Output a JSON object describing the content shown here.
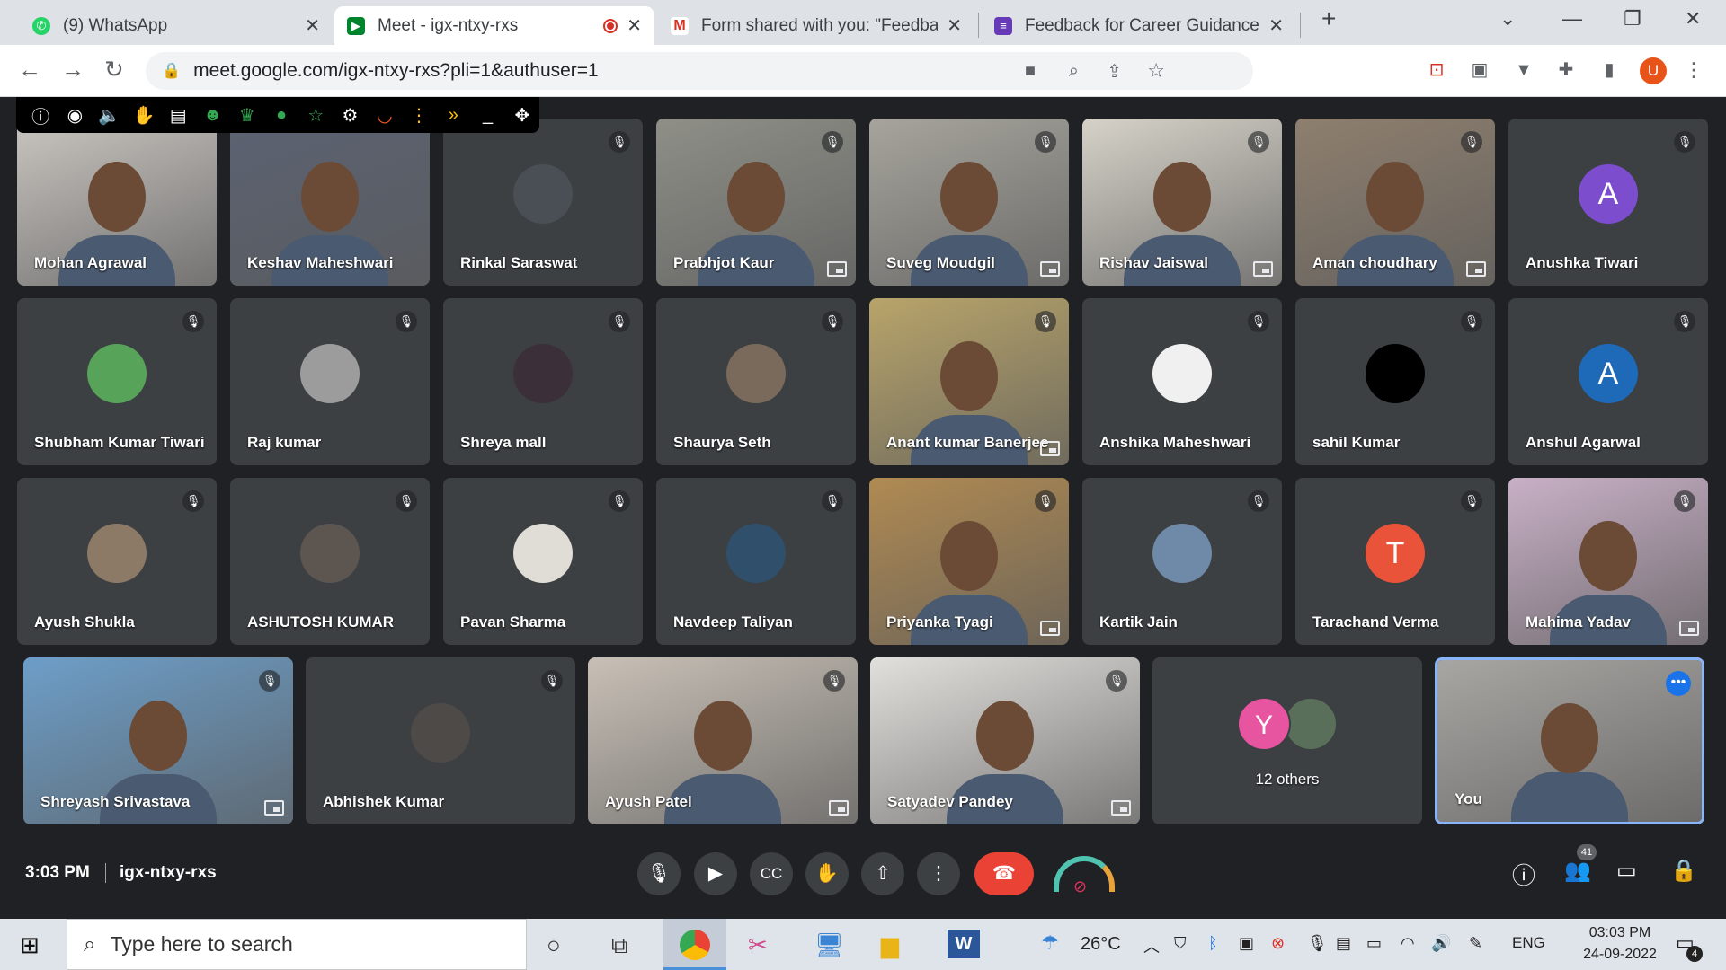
{
  "browser": {
    "tabs": [
      {
        "title": "(9) WhatsApp",
        "icon": "whatsapp-icon",
        "active": false
      },
      {
        "title": "Meet - igx-ntxy-rxs",
        "icon": "google-meet-icon",
        "active": true
      },
      {
        "title": "Form shared with you: \"Feedback",
        "icon": "gmail-icon",
        "active": false
      },
      {
        "title": "Feedback for Career Guidance Ta",
        "icon": "google-forms-icon",
        "active": false
      }
    ],
    "url": "meet.google.com/igx-ntxy-rxs?pli=1&authuser=1",
    "profile_initial": "U"
  },
  "participants": [
    {
      "name": "Mohan Agrawal",
      "kind": "video",
      "bg": "#c9c5c0",
      "muted": false
    },
    {
      "name": "Keshav Maheshwari",
      "kind": "video",
      "bg": "#5b6272",
      "muted": false
    },
    {
      "name": "Rinkal Saraswat",
      "kind": "photo",
      "bg": "#4a4f55",
      "muted": true
    },
    {
      "name": "Prabhjot Kaur",
      "kind": "video",
      "bg": "#8f8f88",
      "muted": true
    },
    {
      "name": "Suveg Moudgil",
      "kind": "video",
      "bg": "#a6a49c",
      "muted": true
    },
    {
      "name": "Rishav Jaiswal",
      "kind": "video",
      "bg": "#d6d2c8",
      "muted": true
    },
    {
      "name": "Aman choudhary",
      "kind": "video",
      "bg": "#8e7f6e",
      "muted": true
    },
    {
      "name": "Anushka Tiwari",
      "kind": "letter",
      "letter": "A",
      "color": "#7c4dcc",
      "muted": true
    },
    {
      "name": "Shubham Kumar Tiwari",
      "kind": "photo",
      "bg": "#58a35a",
      "muted": true
    },
    {
      "name": "Raj kumar",
      "kind": "photo",
      "bg": "#9c9c9c",
      "muted": true
    },
    {
      "name": "Shreya mall",
      "kind": "photo",
      "bg": "#3b2f3a",
      "muted": true
    },
    {
      "name": "Shaurya Seth",
      "kind": "photo",
      "bg": "#7a6a5c",
      "muted": true
    },
    {
      "name": "Anant kumar Banerjee",
      "kind": "video",
      "bg": "#b8a46a",
      "muted": true
    },
    {
      "name": "Anshika Maheshwari",
      "kind": "photo",
      "bg": "#f0f0f0",
      "muted": true
    },
    {
      "name": "sahil Kumar",
      "kind": "photo",
      "bg": "#000000",
      "muted": true
    },
    {
      "name": "Anshul Agarwal",
      "kind": "letter",
      "letter": "A",
      "color": "#1e6ab8",
      "muted": true
    },
    {
      "name": "Ayush Shukla",
      "kind": "photo",
      "bg": "#8d7a66",
      "muted": true
    },
    {
      "name": "ASHUTOSH KUMAR",
      "kind": "photo",
      "bg": "#5d5550",
      "muted": true
    },
    {
      "name": "Pavan Sharma",
      "kind": "photo",
      "bg": "#e0dcd6",
      "muted": true
    },
    {
      "name": "Navdeep Taliyan",
      "kind": "photo",
      "bg": "#2f4f6a",
      "muted": true
    },
    {
      "name": "Priyanka Tyagi",
      "kind": "video",
      "bg": "#b08a52",
      "muted": true
    },
    {
      "name": "Kartik Jain",
      "kind": "photo",
      "bg": "#6f8aa8",
      "muted": true
    },
    {
      "name": "Tarachand Verma",
      "kind": "letter",
      "letter": "T",
      "color": "#e8533a",
      "muted": true
    },
    {
      "name": "Mahima Yadav",
      "kind": "video",
      "bg": "#c8b0c6",
      "muted": true
    },
    {
      "name": "Shreyash Srivastava",
      "kind": "video",
      "bg": "#6d9ec8",
      "muted": true
    },
    {
      "name": "Abhishek Kumar",
      "kind": "photo",
      "bg": "#4d4a48",
      "muted": true
    },
    {
      "name": "Ayush Patel",
      "kind": "video",
      "bg": "#c8c0b6",
      "muted": true
    },
    {
      "name": "Satyadev Pandey",
      "kind": "video",
      "bg": "#e2e0dc",
      "muted": true
    },
    {
      "name": "12 others",
      "kind": "others",
      "letter": "Y",
      "color": "#e754a0",
      "muted": false
    },
    {
      "name": "You",
      "kind": "video",
      "bg": "#a8a6a2",
      "muted": false
    }
  ],
  "meeting": {
    "time": "3:03 PM",
    "code": "igx-ntxy-rxs",
    "participant_count": "41"
  },
  "taskbar": {
    "search_placeholder": "Type here to search",
    "weather": "26°C",
    "lang": "ENG",
    "time": "03:03 PM",
    "date": "24-09-2022",
    "notifications": "4"
  }
}
